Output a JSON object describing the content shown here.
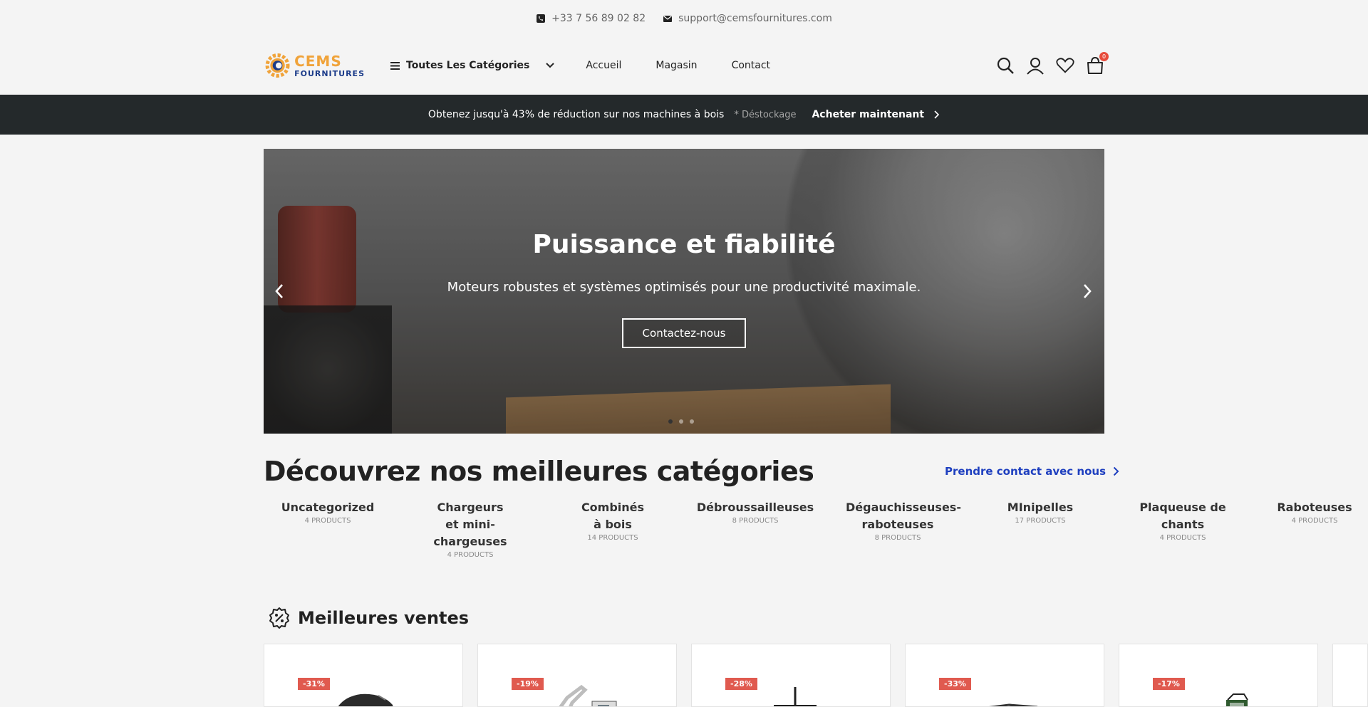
{
  "topbar": {
    "phone": "+33 7 56 89 02 82",
    "email": "support@cemsfournitures.com"
  },
  "logo": {
    "line1": "CEMS",
    "line2": "FOURNITURES"
  },
  "header": {
    "categories_label": "Toutes Les Catégories",
    "nav": [
      "Accueil",
      "Magasin",
      "Contact"
    ],
    "cart_count": "0"
  },
  "promo": {
    "text": "Obtenez jusqu'à 43% de réduction sur nos machines à bois",
    "tag": "* Déstockage",
    "cta": "Acheter maintenant"
  },
  "hero": {
    "title": "Puissance et fiabilité",
    "subtitle": "Moteurs robustes et systèmes optimisés pour une productivité maximale.",
    "button": "Contactez-nous"
  },
  "categories_section": {
    "title": "Découvrez nos meilleures catégories",
    "contact_link": "Prendre contact avec nous",
    "items": [
      {
        "name": "Uncategorized",
        "count": "4 PRODUCTS"
      },
      {
        "name": "Chargeurs et mini-chargeuses",
        "count": "4 PRODUCTS"
      },
      {
        "name": "Combinés à bois",
        "count": "14 PRODUCTS"
      },
      {
        "name": "Débroussailleuses",
        "count": "8 PRODUCTS"
      },
      {
        "name": "Dégauchisseuses-raboteuses",
        "count": "8 PRODUCTS"
      },
      {
        "name": "MInipelles",
        "count": "17 PRODUCTS"
      },
      {
        "name": "Plaqueuse de chants",
        "count": "4 PRODUCTS"
      },
      {
        "name": "Raboteuses",
        "count": "4 PRODUCTS"
      }
    ]
  },
  "best_sellers": {
    "title": "Meilleures ventes",
    "discounts": [
      "-31%",
      "-19%",
      "-28%",
      "-33%",
      "-17%"
    ]
  },
  "colors": {
    "promo_bg": "#24292b",
    "link": "#1e3fbf",
    "discount": "#e05a4f",
    "logo_orange": "#f0a33a",
    "logo_blue": "#1c3c8a"
  }
}
